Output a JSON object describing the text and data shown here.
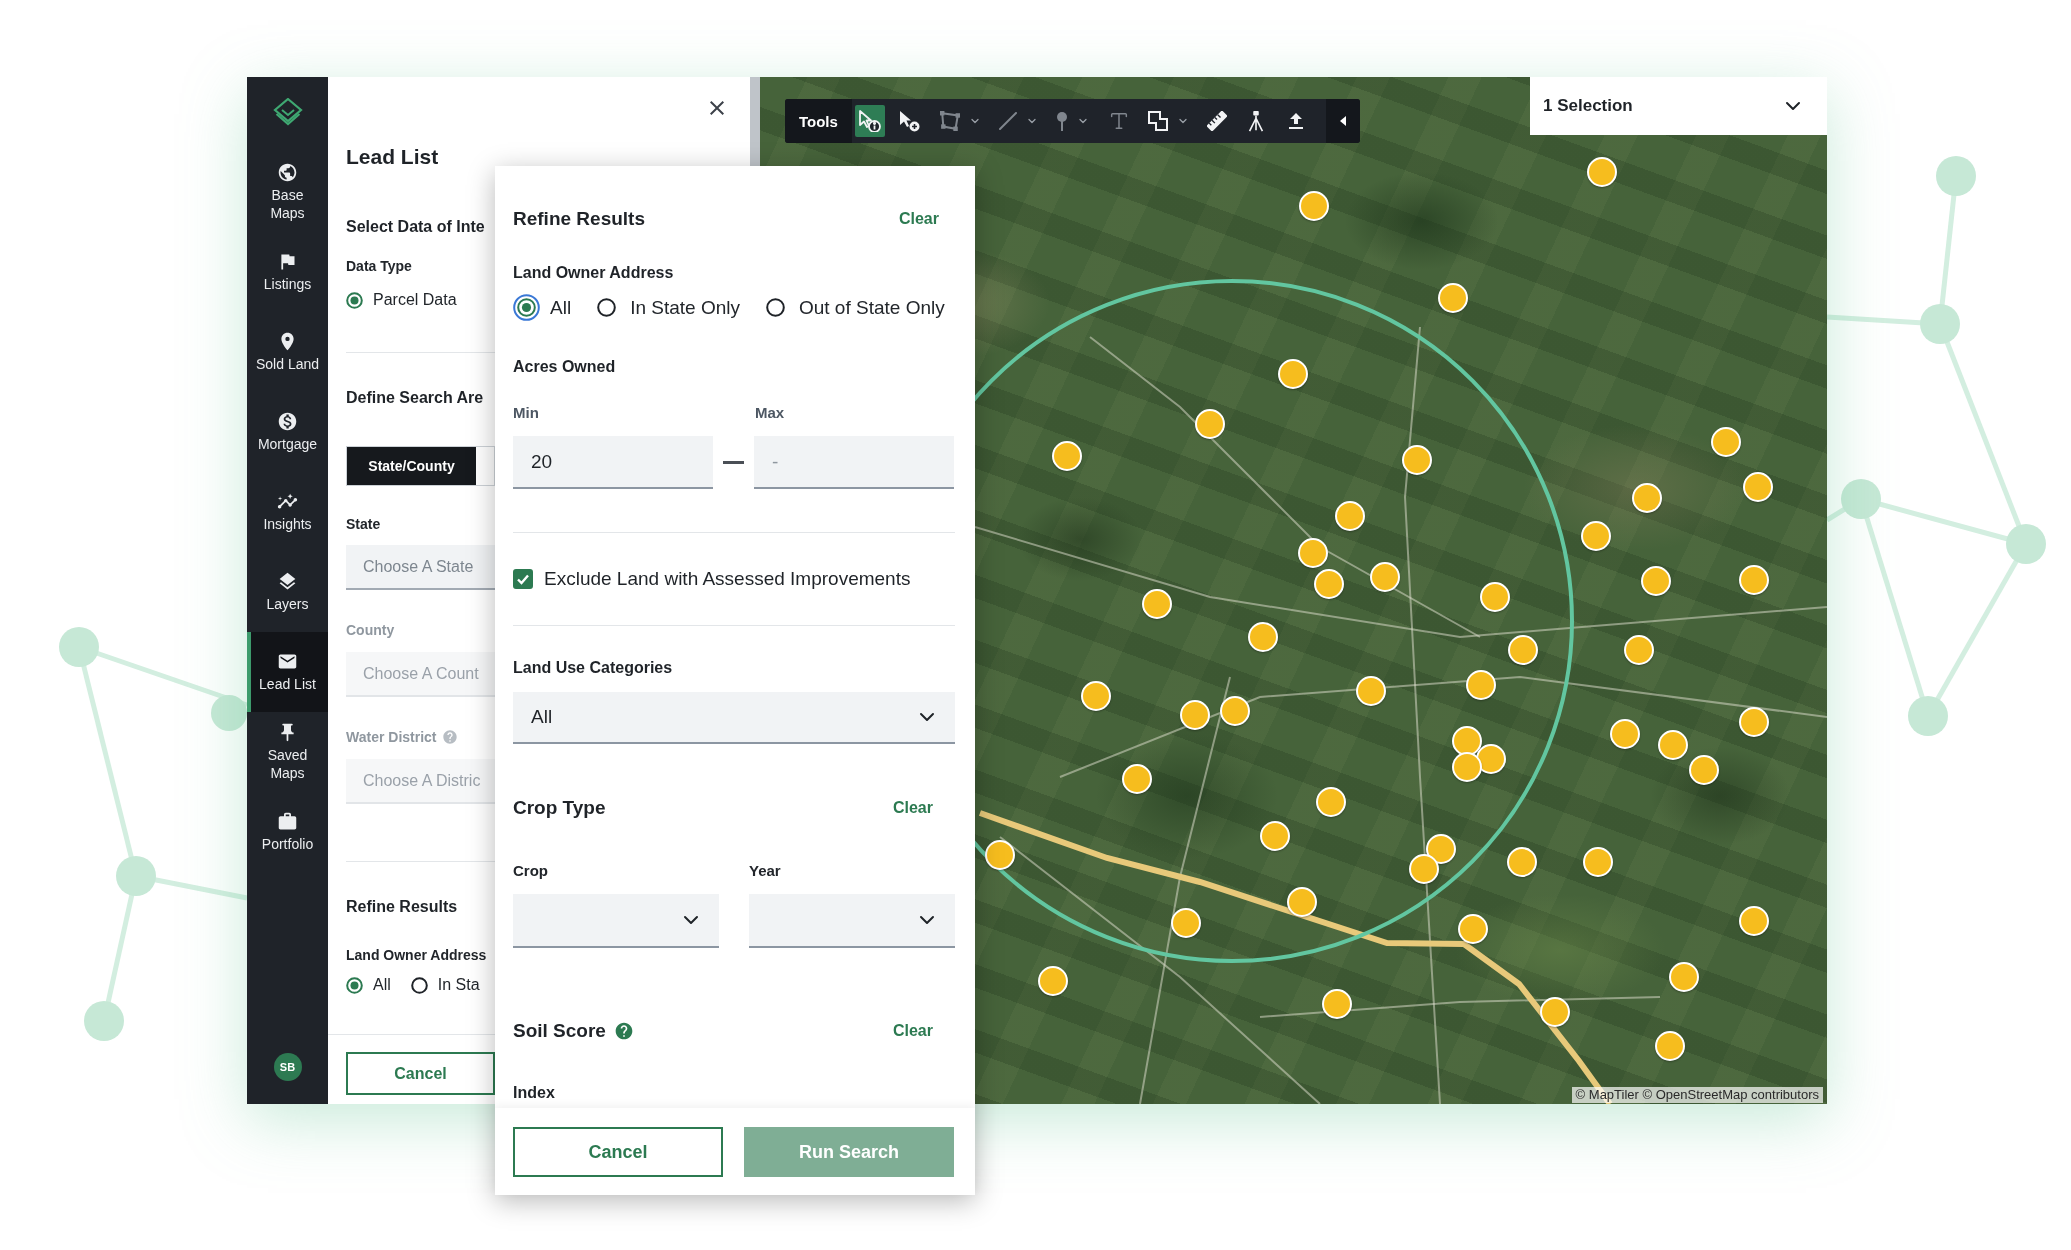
{
  "sidebar": {
    "items": [
      {
        "label": "Base Maps",
        "selected": false
      },
      {
        "label": "Listings",
        "selected": false
      },
      {
        "label": "Sold Land",
        "selected": false
      },
      {
        "label": "Mortgage",
        "selected": false
      },
      {
        "label": "Insights",
        "selected": false
      },
      {
        "label": "Layers",
        "selected": false
      },
      {
        "label": "Lead List",
        "selected": true
      },
      {
        "label": "Saved Maps",
        "selected": false
      },
      {
        "label": "Portfolio",
        "selected": false
      }
    ],
    "avatar": "SB"
  },
  "lead_list": {
    "title": "Lead List",
    "data_heading": "Select Data of Inte",
    "data_type": {
      "label": "Data Type",
      "options": [
        {
          "label": "Parcel Data",
          "selected": true
        }
      ]
    },
    "search_area": {
      "heading": "Define Search Are",
      "modes": [
        {
          "label": "State/County",
          "selected": true
        }
      ],
      "fields": [
        {
          "label": "State",
          "placeholder": "Choose A State",
          "disabled": false,
          "help": false
        },
        {
          "label": "County",
          "placeholder": "Choose A Count",
          "disabled": true,
          "help": false
        },
        {
          "label": "Water District",
          "placeholder": "Choose A Distric",
          "disabled": true,
          "help": true
        }
      ]
    },
    "refine": {
      "heading": "Refine Results",
      "owner_label": "Land Owner Address",
      "options": [
        {
          "label": "All",
          "selected": true
        },
        {
          "label": "In Sta",
          "selected": false
        }
      ]
    },
    "cancel": "Cancel"
  },
  "refine_popup": {
    "title": "Refine Results",
    "clear": "Clear",
    "owner": {
      "label": "Land Owner Address",
      "options": [
        {
          "label": "All",
          "selected": true
        },
        {
          "label": "In State Only",
          "selected": false
        },
        {
          "label": "Out of State Only",
          "selected": false
        }
      ]
    },
    "acres": {
      "label": "Acres Owned",
      "min": {
        "label": "Min",
        "value": "20"
      },
      "max": {
        "label": "Max",
        "placeholder": "-"
      }
    },
    "exclude_improvements": {
      "label": "Exclude Land with Assessed Improvements",
      "checked": true
    },
    "land_use": {
      "label": "Land Use Categories",
      "value": "All"
    },
    "crop_type": {
      "title": "Crop Type",
      "clear": "Clear",
      "crop": {
        "label": "Crop"
      },
      "year": {
        "label": "Year"
      }
    },
    "soil_score": {
      "title": "Soil Score",
      "clear": "Clear",
      "index_label": "Index"
    },
    "buttons": [
      {
        "label": "Cancel",
        "kind": "secondary",
        "disabled": false
      },
      {
        "label": "Run Search",
        "kind": "primary",
        "disabled": true
      }
    ]
  },
  "map": {
    "toolbar": {
      "label": "Tools",
      "tools": [
        {
          "selected": true,
          "disabled": false,
          "has_menu": false
        },
        {
          "selected": false,
          "disabled": false,
          "has_menu": false
        },
        {
          "selected": false,
          "disabled": true,
          "has_menu": true
        },
        {
          "selected": false,
          "disabled": true,
          "has_menu": true
        },
        {
          "selected": false,
          "disabled": true,
          "has_menu": true
        },
        {
          "selected": false,
          "disabled": true,
          "has_menu": false
        },
        {
          "selected": false,
          "disabled": false,
          "has_menu": true
        },
        {
          "selected": false,
          "disabled": false,
          "has_menu": false
        },
        {
          "selected": false,
          "disabled": false,
          "has_menu": false
        },
        {
          "selected": false,
          "disabled": false,
          "has_menu": false
        }
      ]
    },
    "selection": {
      "value": "1 Selection"
    },
    "attribution": "© MapTiler © OpenStreetMap contributors"
  }
}
